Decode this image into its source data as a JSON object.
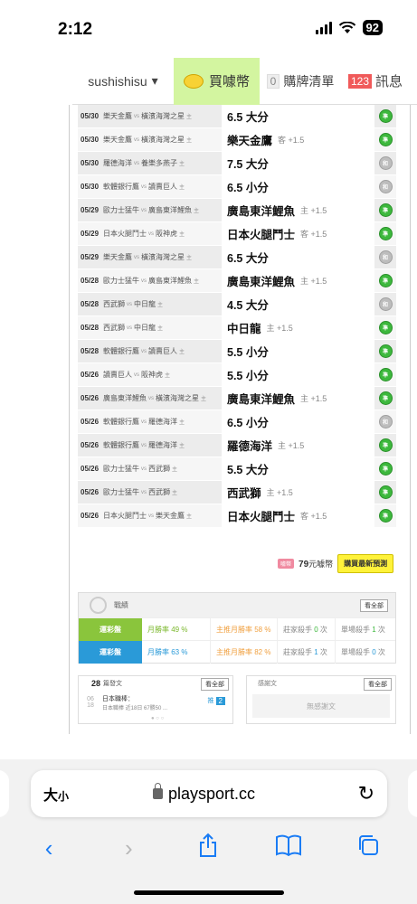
{
  "status": {
    "time": "2:12",
    "battery": "92"
  },
  "nav": {
    "user": "sushishisu",
    "user_caret": "▾",
    "buy": "買噱幣",
    "list_count": "0",
    "list_label": "購牌清單",
    "msg_count": "123",
    "msg_label": "訊息"
  },
  "predictions": [
    {
      "date": "05/30",
      "home": "樂天金鷹",
      "away": "橫濱海灣之星",
      "away_tag": "主",
      "pick": "6.5 大分",
      "sub": "",
      "result": "win"
    },
    {
      "date": "05/30",
      "home": "樂天金鷹",
      "away": "橫濱海灣之星",
      "away_tag": "主",
      "pick": "樂天金鷹",
      "sub": "客 +1.5",
      "result": "win"
    },
    {
      "date": "05/30",
      "home": "羅德海洋",
      "away": "養樂多燕子",
      "away_tag": "主",
      "pick": "7.5 大分",
      "sub": "",
      "result": "draw"
    },
    {
      "date": "05/30",
      "home": "軟體銀行鷹",
      "away": "讀賣巨人",
      "away_tag": "主",
      "pick": "6.5 小分",
      "sub": "",
      "result": "draw"
    },
    {
      "date": "05/29",
      "home": "歐力士猛牛",
      "away": "廣島東洋鯉魚",
      "away_tag": "主",
      "pick": "廣島東洋鯉魚",
      "sub": "主 +1.5",
      "result": "win"
    },
    {
      "date": "05/29",
      "home": "日本火腿鬥士",
      "away": "阪神虎",
      "away_tag": "主",
      "pick": "日本火腿鬥士",
      "sub": "客 +1.5",
      "result": "win"
    },
    {
      "date": "05/29",
      "home": "樂天金鷹",
      "away": "橫濱海灣之星",
      "away_tag": "主",
      "pick": "6.5 大分",
      "sub": "",
      "result": "draw"
    },
    {
      "date": "05/28",
      "home": "歐力士猛牛",
      "away": "廣島東洋鯉魚",
      "away_tag": "主",
      "pick": "廣島東洋鯉魚",
      "sub": "主 +1.5",
      "result": "win"
    },
    {
      "date": "05/28",
      "home": "西武獅",
      "away": "中日龍",
      "away_tag": "主",
      "pick": "4.5 大分",
      "sub": "",
      "result": "draw"
    },
    {
      "date": "05/28",
      "home": "西武獅",
      "away": "中日龍",
      "away_tag": "主",
      "pick": "中日龍",
      "sub": "主 +1.5",
      "result": "win"
    },
    {
      "date": "05/28",
      "home": "軟體銀行鷹",
      "away": "讀賣巨人",
      "away_tag": "主",
      "pick": "5.5 小分",
      "sub": "",
      "result": "win"
    },
    {
      "date": "05/26",
      "home": "讀賣巨人",
      "away": "阪神虎",
      "away_tag": "主",
      "pick": "5.5 小分",
      "sub": "",
      "result": "win"
    },
    {
      "date": "05/26",
      "home": "廣島東洋鯉魚",
      "away": "橫濱海灣之星",
      "away_tag": "主",
      "pick": "廣島東洋鯉魚",
      "sub": "主 +1.5",
      "result": "win"
    },
    {
      "date": "05/26",
      "home": "軟體銀行鷹",
      "away": "羅德海洋",
      "away_tag": "主",
      "pick": "6.5 小分",
      "sub": "",
      "result": "draw"
    },
    {
      "date": "05/26",
      "home": "軟體銀行鷹",
      "away": "羅德海洋",
      "away_tag": "主",
      "pick": "羅德海洋",
      "sub": "主 +1.5",
      "result": "win"
    },
    {
      "date": "05/26",
      "home": "歐力士猛牛",
      "away": "西武獅",
      "away_tag": "主",
      "pick": "5.5 大分",
      "sub": "",
      "result": "win"
    },
    {
      "date": "05/26",
      "home": "歐力士猛牛",
      "away": "西武獅",
      "away_tag": "主",
      "pick": "西武獅",
      "sub": "主 +1.5",
      "result": "win"
    },
    {
      "date": "05/26",
      "home": "日本火腿鬥士",
      "away": "樂天金鷹",
      "away_tag": "主",
      "pick": "日本火腿鬥士",
      "sub": "客 +1.5",
      "result": "win"
    }
  ],
  "vs_text": "vs",
  "result_labels": {
    "win": "準",
    "draw": "和"
  },
  "purchase": {
    "badge": "噱幣",
    "price": "79",
    "unit": "元噱幣",
    "button": "購買最新預測"
  },
  "record": {
    "title": "戰績",
    "view_all": "看全部",
    "rows": [
      {
        "tag": "運彩盤",
        "month_label": "月勝率",
        "month": "49 %",
        "main_label": "主推月勝率",
        "main": "58 %",
        "killer_label": "莊家殺手",
        "killer": "0",
        "killer_unit": "次",
        "single_label": "單場殺手",
        "single": "1",
        "single_unit": "次"
      },
      {
        "tag": "運彩盤",
        "month_label": "月勝率",
        "month": "63 %",
        "main_label": "主推月勝率",
        "main": "82 %",
        "killer_label": "莊家殺手",
        "killer": "1",
        "killer_unit": "次",
        "single_label": "單場殺手",
        "single": "0",
        "single_unit": "次"
      }
    ]
  },
  "posts": {
    "count": "28",
    "label": "篇發文",
    "view_all": "看全部",
    "date_month": "06",
    "date_day": "18",
    "title": "日本職棒：",
    "snippet": "日本職棒 近18日 67勝50 ...",
    "tag": "推",
    "num": "2"
  },
  "thanks": {
    "label": "感謝文",
    "view_all": "看全部",
    "empty": "無感謝文"
  },
  "browser": {
    "text_size_big": "大",
    "text_size_small": "小",
    "url": "playsport.cc"
  }
}
